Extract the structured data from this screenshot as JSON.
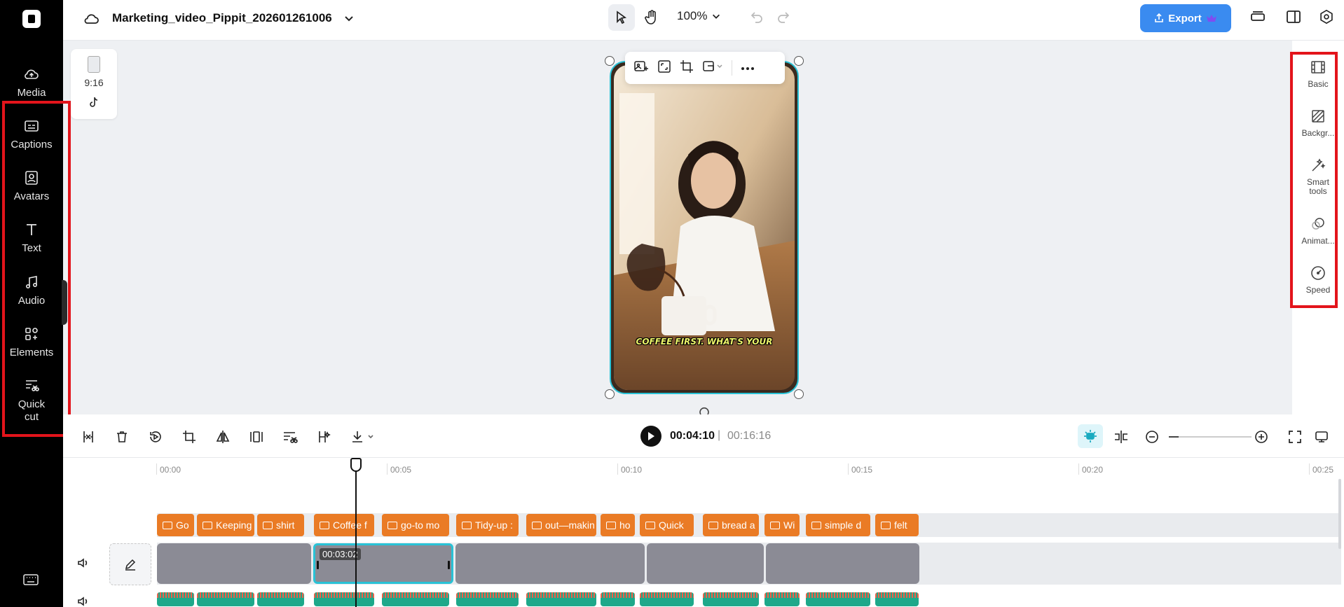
{
  "app": {
    "project_title": "Marketing_video_Pippit_202601261006",
    "zoom": "100%",
    "export_label": "Export"
  },
  "left_sidebar": {
    "items": [
      {
        "label": "Media",
        "icon": "cloud-upload-icon"
      },
      {
        "label": "Captions",
        "icon": "captions-icon"
      },
      {
        "label": "Avatars",
        "icon": "avatar-icon"
      },
      {
        "label": "Text",
        "icon": "text-icon"
      },
      {
        "label": "Audio",
        "icon": "music-note-icon"
      },
      {
        "label": "Elements",
        "icon": "elements-icon"
      },
      {
        "label": "Quick\ncut",
        "icon": "quick-cut-icon"
      }
    ],
    "highlight_color": "#e3141b"
  },
  "ratio_card": {
    "ratio": "9:16",
    "platform_icon": "tiktok-icon"
  },
  "preview": {
    "caption_overlay": "COFFEE FIRST. WHAT'S YOUR"
  },
  "right_sidebar": {
    "items": [
      {
        "label": "Basic",
        "icon": "film-icon"
      },
      {
        "label": "Backgr...",
        "icon": "background-icon"
      },
      {
        "label": "Smart tools",
        "icon": "magic-wand-icon"
      },
      {
        "label": "Animat...",
        "icon": "animation-icon"
      },
      {
        "label": "Speed",
        "icon": "speedometer-icon"
      }
    ]
  },
  "playback": {
    "current_time": "00:04:10",
    "separator": "|",
    "total_time": "00:16:16"
  },
  "ruler": {
    "labels": [
      "00:00",
      "00:05",
      "00:10",
      "00:15",
      "00:20",
      "00:25"
    ]
  },
  "captions": [
    {
      "text": "Go"
    },
    {
      "text": "Keeping"
    },
    {
      "text": "shirt"
    },
    {
      "text": "Coffee f"
    },
    {
      "text": "go-to mo"
    },
    {
      "text": "Tidy-up :"
    },
    {
      "text": "out—makin"
    },
    {
      "text": "ho"
    },
    {
      "text": "Quick"
    },
    {
      "text": "bread a"
    },
    {
      "text": "Wi"
    },
    {
      "text": "simple d"
    },
    {
      "text": "felt"
    }
  ],
  "video_track": {
    "selected_clip_duration": "00:03:02"
  },
  "colors": {
    "accent": "#29c2d6",
    "export_blue": "#3a8bf0",
    "caption_orange": "#ea7b25",
    "audio_green": "#1ea88a"
  }
}
